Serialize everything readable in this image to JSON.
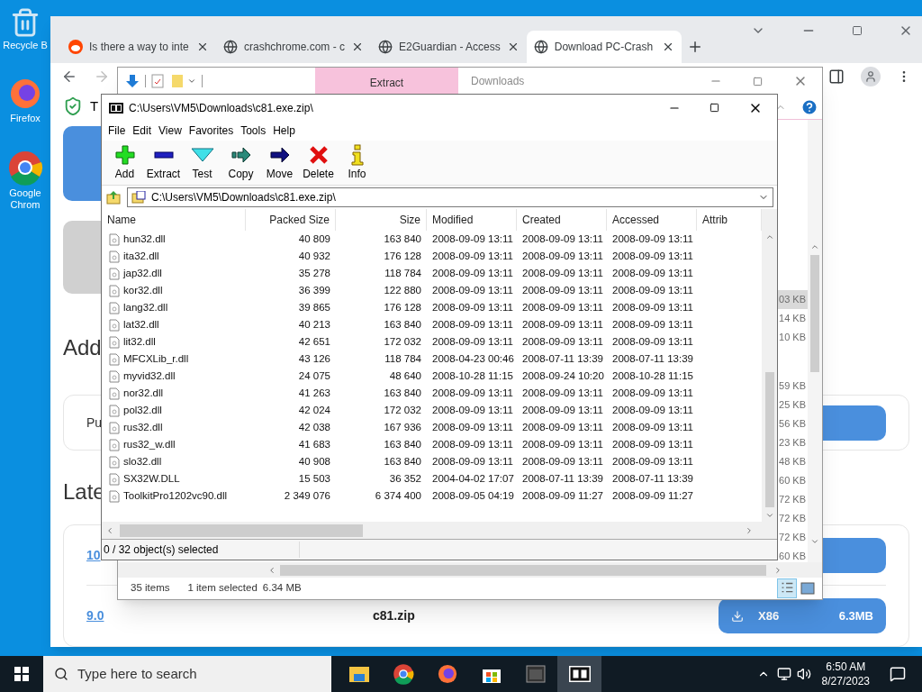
{
  "desktop_icons": [
    {
      "label": "Recycle B",
      "kind": "recycle"
    },
    {
      "label": "Firefox",
      "kind": "firefox"
    },
    {
      "label": "Google Chrom",
      "kind": "chrome"
    }
  ],
  "browser": {
    "tabs": [
      {
        "title": "Is there a way to inte",
        "kind": "reddit",
        "selected": false
      },
      {
        "title": "crashchrome.com - c",
        "kind": "globe",
        "selected": false
      },
      {
        "title": "E2Guardian - Access",
        "kind": "globe",
        "selected": false
      },
      {
        "title": "Download PC-Crash",
        "kind": "globe",
        "selected": true
      }
    ],
    "page": {
      "shield_text": "T",
      "heading_1": "Add",
      "card_text": "Pu",
      "heading_2": "Late",
      "version_links": [
        "10",
        "9.0"
      ],
      "file_name": "c81.zip",
      "download_button": {
        "label": "X86",
        "size": "6.3MB"
      }
    }
  },
  "explorer": {
    "contextual_tab": "Extract",
    "title": "Downloads",
    "size_groups": [
      {
        "items": [
          {
            "size": "03 KB",
            "selected": true
          },
          {
            "size": "14 KB",
            "selected": false
          },
          {
            "size": "10 KB",
            "selected": false
          }
        ]
      },
      {
        "items": [
          {
            "size": "59 KB",
            "selected": false
          },
          {
            "size": "25 KB",
            "selected": false
          },
          {
            "size": "56 KB",
            "selected": false
          },
          {
            "size": "23 KB",
            "selected": false
          },
          {
            "size": "48 KB",
            "selected": false
          },
          {
            "size": "60 KB",
            "selected": false
          },
          {
            "size": "72 KB",
            "selected": false
          },
          {
            "size": "72 KB",
            "selected": false
          },
          {
            "size": "72 KB",
            "selected": false
          },
          {
            "size": "60 KB",
            "selected": false
          }
        ]
      }
    ],
    "status": {
      "items": "35 items",
      "selection": "1 item selected",
      "selection_size": "6.34 MB"
    }
  },
  "sevenzip": {
    "title": "C:\\Users\\VM5\\Downloads\\c81.exe.zip\\",
    "menu": [
      "File",
      "Edit",
      "View",
      "Favorites",
      "Tools",
      "Help"
    ],
    "toolbar": [
      {
        "label": "Add",
        "kind": "add"
      },
      {
        "label": "Extract",
        "kind": "extract"
      },
      {
        "label": "Test",
        "kind": "test"
      },
      {
        "label": "Copy",
        "kind": "copy"
      },
      {
        "label": "Move",
        "kind": "move"
      },
      {
        "label": "Delete",
        "kind": "delete"
      },
      {
        "label": "Info",
        "kind": "info"
      }
    ],
    "address": "C:\\Users\\VM5\\Downloads\\c81.exe.zip\\",
    "columns": [
      "Name",
      "Packed Size",
      "Size",
      "Modified",
      "Created",
      "Accessed",
      "Attrib"
    ],
    "rows": [
      [
        "hun32.dll",
        "40 809",
        "163 840",
        "2008-09-09 13:11",
        "2008-09-09 13:11",
        "2008-09-09 13:11"
      ],
      [
        "ita32.dll",
        "40 932",
        "176 128",
        "2008-09-09 13:11",
        "2008-09-09 13:11",
        "2008-09-09 13:11"
      ],
      [
        "jap32.dll",
        "35 278",
        "118 784",
        "2008-09-09 13:11",
        "2008-09-09 13:11",
        "2008-09-09 13:11"
      ],
      [
        "kor32.dll",
        "36 399",
        "122 880",
        "2008-09-09 13:11",
        "2008-09-09 13:11",
        "2008-09-09 13:11"
      ],
      [
        "lang32.dll",
        "39 865",
        "176 128",
        "2008-09-09 13:11",
        "2008-09-09 13:11",
        "2008-09-09 13:11"
      ],
      [
        "lat32.dll",
        "40 213",
        "163 840",
        "2008-09-09 13:11",
        "2008-09-09 13:11",
        "2008-09-09 13:11"
      ],
      [
        "lit32.dll",
        "42 651",
        "172 032",
        "2008-09-09 13:11",
        "2008-09-09 13:11",
        "2008-09-09 13:11"
      ],
      [
        "MFCXLib_r.dll",
        "43 126",
        "118 784",
        "2008-04-23 00:46",
        "2008-07-11 13:39",
        "2008-07-11 13:39"
      ],
      [
        "myvid32.dll",
        "24 075",
        "48 640",
        "2008-10-28 11:15",
        "2008-09-24 10:20",
        "2008-10-28 11:15"
      ],
      [
        "nor32.dll",
        "41 263",
        "163 840",
        "2008-09-09 13:11",
        "2008-09-09 13:11",
        "2008-09-09 13:11"
      ],
      [
        "pol32.dll",
        "42 024",
        "172 032",
        "2008-09-09 13:11",
        "2008-09-09 13:11",
        "2008-09-09 13:11"
      ],
      [
        "rus32.dll",
        "42 038",
        "167 936",
        "2008-09-09 13:11",
        "2008-09-09 13:11",
        "2008-09-09 13:11"
      ],
      [
        "rus32_w.dll",
        "41 683",
        "163 840",
        "2008-09-09 13:11",
        "2008-09-09 13:11",
        "2008-09-09 13:11"
      ],
      [
        "slo32.dll",
        "40 908",
        "163 840",
        "2008-09-09 13:11",
        "2008-09-09 13:11",
        "2008-09-09 13:11"
      ],
      [
        "SX32W.DLL",
        "15 503",
        "36 352",
        "2004-04-02 17:07",
        "2008-07-11 13:39",
        "2008-07-11 13:39"
      ],
      [
        "ToolkitPro1202vc90.dll",
        "2 349 076",
        "6 374 400",
        "2008-09-05 04:19",
        "2008-09-09 11:27",
        "2008-09-09 11:27"
      ]
    ],
    "status": "0 / 32 object(s) selected"
  },
  "taskbar": {
    "search_placeholder": "Type here to search",
    "apps": [
      {
        "kind": "explorer",
        "active": false
      },
      {
        "kind": "chrome",
        "active": false
      },
      {
        "kind": "firefox",
        "active": false
      },
      {
        "kind": "store",
        "active": false
      },
      {
        "kind": "terminal",
        "active": false
      },
      {
        "kind": "sevenzip",
        "active": true
      }
    ],
    "time": "6:50 AM",
    "date": "8/27/2023"
  }
}
